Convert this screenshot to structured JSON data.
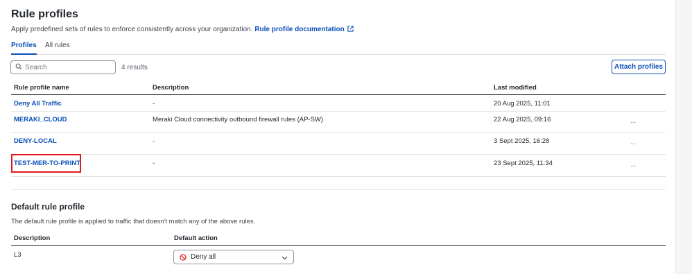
{
  "page": {
    "title": "Rule profiles",
    "subtitle": "Apply predefined sets of rules to enforce consistently across your organization.",
    "doc_link": "Rule profile documentation"
  },
  "tabs": [
    {
      "label": "Profiles",
      "active": true
    },
    {
      "label": "All rules",
      "active": false
    }
  ],
  "search": {
    "placeholder": "Search",
    "value": ""
  },
  "results_count": "4 results",
  "attach_button": "Attach profiles",
  "table": {
    "columns": [
      "Rule profile name",
      "Description",
      "Last modified"
    ],
    "rows": [
      {
        "name": "Deny All Traffic",
        "description": "-",
        "modified": "20 Aug 2025, 11:01",
        "more": ""
      },
      {
        "name": "MERAKI_CLOUD",
        "description": "Meraki Cloud connectivity outbound firewall rules (AP-SW)",
        "modified": "22 Aug 2025, 09:16",
        "more": "..."
      },
      {
        "name": "DENY-LOCAL",
        "description": "-",
        "modified": "3 Sept 2025, 16:28",
        "more": "..."
      },
      {
        "name": "TEST-MER-TO-PRINT",
        "description": "-",
        "modified": "23 Sept 2025, 11:34",
        "more": "..."
      }
    ]
  },
  "default_profile": {
    "title": "Default rule profile",
    "subtitle": "The default rule profile is applied to traffic that doesn't match any of the above rules.",
    "columns": [
      "Description",
      "Default action"
    ],
    "row": {
      "description": "L3",
      "action": "Deny all"
    }
  },
  "colors": {
    "accent": "#0a4fb8",
    "highlight": "#e0191f",
    "deny": "#d92b2b"
  },
  "icons": [
    "search-icon",
    "external-link-icon",
    "more-icon",
    "deny-icon",
    "chevron-down-icon"
  ]
}
